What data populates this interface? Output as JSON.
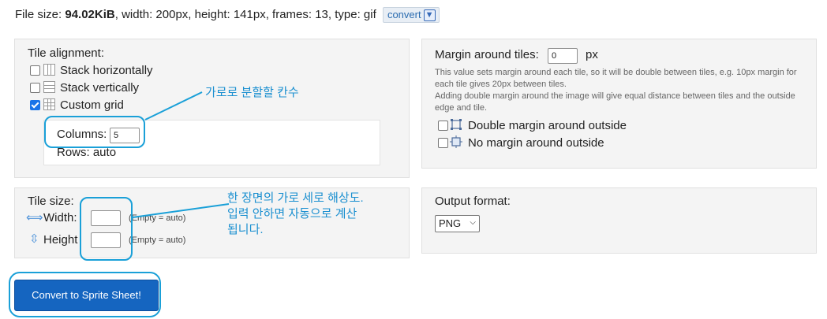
{
  "file_info": {
    "size_label": "File size: ",
    "size_value": "94.02KiB",
    "rest": ", width: 200px, height: 141px, frames: 13, type: gif",
    "convert_label": "convert"
  },
  "alignment": {
    "title": "Tile alignment:",
    "options": [
      {
        "label": "Stack horizontally",
        "checked": false,
        "icon": "stack-horizontal-icon"
      },
      {
        "label": "Stack vertically",
        "checked": false,
        "icon": "stack-vertical-icon"
      },
      {
        "label": "Custom grid",
        "checked": true,
        "icon": "grid-icon"
      }
    ],
    "columns_label": "Columns:",
    "columns_value": "5",
    "rows_label": "Rows: auto"
  },
  "margin": {
    "label": "Margin around tiles:",
    "value": "0",
    "unit": "px",
    "help1": "This value sets margin around each tile, so it will be double between tiles, e.g. 10px margin for each tile gives 20px between tiles.",
    "help2": "Adding double margin around the image will give equal distance between tiles and the outside edge and tile.",
    "options": [
      {
        "label": "Double margin around outside",
        "checked": false,
        "icon": "double-margin-icon"
      },
      {
        "label": "No margin around outside",
        "checked": false,
        "icon": "no-margin-icon"
      }
    ]
  },
  "tile_size": {
    "title": "Tile size:",
    "width_label": "Width:",
    "height_label": "Height",
    "empty_hint": "(Empty = auto)",
    "width_value": "",
    "height_value": ""
  },
  "output": {
    "label": "Output format:",
    "selected": "PNG"
  },
  "convert_button": "Convert to Sprite Sheet!",
  "annotations": {
    "columns_note": "가로로 분할할 칸수",
    "size_note_1": "한 장면의 가로 세로 해상도.",
    "size_note_2": "입력 안하면 자동으로 계산",
    "size_note_3": "됩니다."
  },
  "colors": {
    "accent": "#1565c0",
    "annotation": "#1aa0d8"
  }
}
